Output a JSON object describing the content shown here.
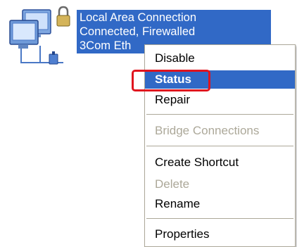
{
  "connection": {
    "name": "Local Area Connection",
    "status": "Connected, Firewalled",
    "device": "3Com Eth",
    "icon": "network-connection-icon",
    "selection_color": "#3169c6"
  },
  "context_menu": {
    "items": [
      {
        "label": "Disable"
      },
      {
        "label": "Status"
      },
      {
        "label": "Repair"
      },
      {
        "label": "Bridge Connections"
      },
      {
        "label": "Create Shortcut"
      },
      {
        "label": "Delete"
      },
      {
        "label": "Rename"
      },
      {
        "label": "Properties"
      }
    ],
    "highlight_color": "#3169c6",
    "callout_color": "#e0141e",
    "disabled_color": "#aca899"
  }
}
